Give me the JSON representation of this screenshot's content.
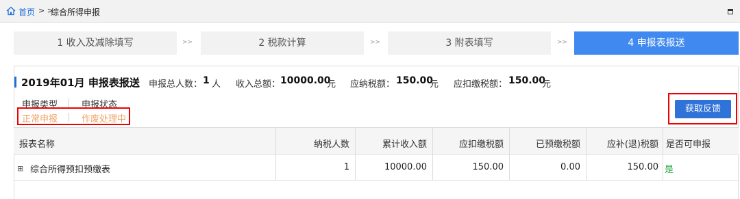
{
  "breadcrumb": {
    "home": "首页",
    "separator": "> >",
    "current": "综合所得申报"
  },
  "steps": [
    {
      "label": "1 收入及减除填写",
      "active": false
    },
    {
      "label": "2 税款计算",
      "active": false
    },
    {
      "label": "3 附表填写",
      "active": false
    },
    {
      "label": "4 申报表报送",
      "active": true
    }
  ],
  "step_arrow": ">>",
  "panel": {
    "title": "2019年01月  申报表报送",
    "summary": {
      "people_label": "申报总人数：",
      "people_value": "1",
      "people_unit": "人",
      "income_label": "收入总额：",
      "income_value": "10000.00",
      "income_unit": "元",
      "tax_label": "应纳税额：",
      "tax_value": "150.00",
      "tax_unit": "元",
      "withhold_label": "应扣缴税额：",
      "withhold_value": "150.00",
      "withhold_unit": "元"
    },
    "status": {
      "type_header": "申报类型",
      "state_header": "申报状态",
      "type_value": "正常申报",
      "state_value": "作废处理中"
    },
    "feedback_button": "获取反馈"
  },
  "table": {
    "columns": [
      "报表名称",
      "纳税人数",
      "累计收入额",
      "应扣缴税额",
      "已预缴税额",
      "应补(退)税额",
      "是否可申报"
    ],
    "rows": [
      {
        "name": "综合所得预扣预缴表",
        "taxpayers": "1",
        "income": "10000.00",
        "withhold": "150.00",
        "prepaid": "0.00",
        "refund": "150.00",
        "can_declare": "是"
      }
    ]
  },
  "colors": {
    "accent": "#4089f0",
    "button": "#2f73d9",
    "status_orange": "#f0a060",
    "highlight_red": "#e00000",
    "yes_green": "#27a844"
  },
  "icons": [
    "home-icon",
    "restore-icon",
    "expand-icon"
  ]
}
